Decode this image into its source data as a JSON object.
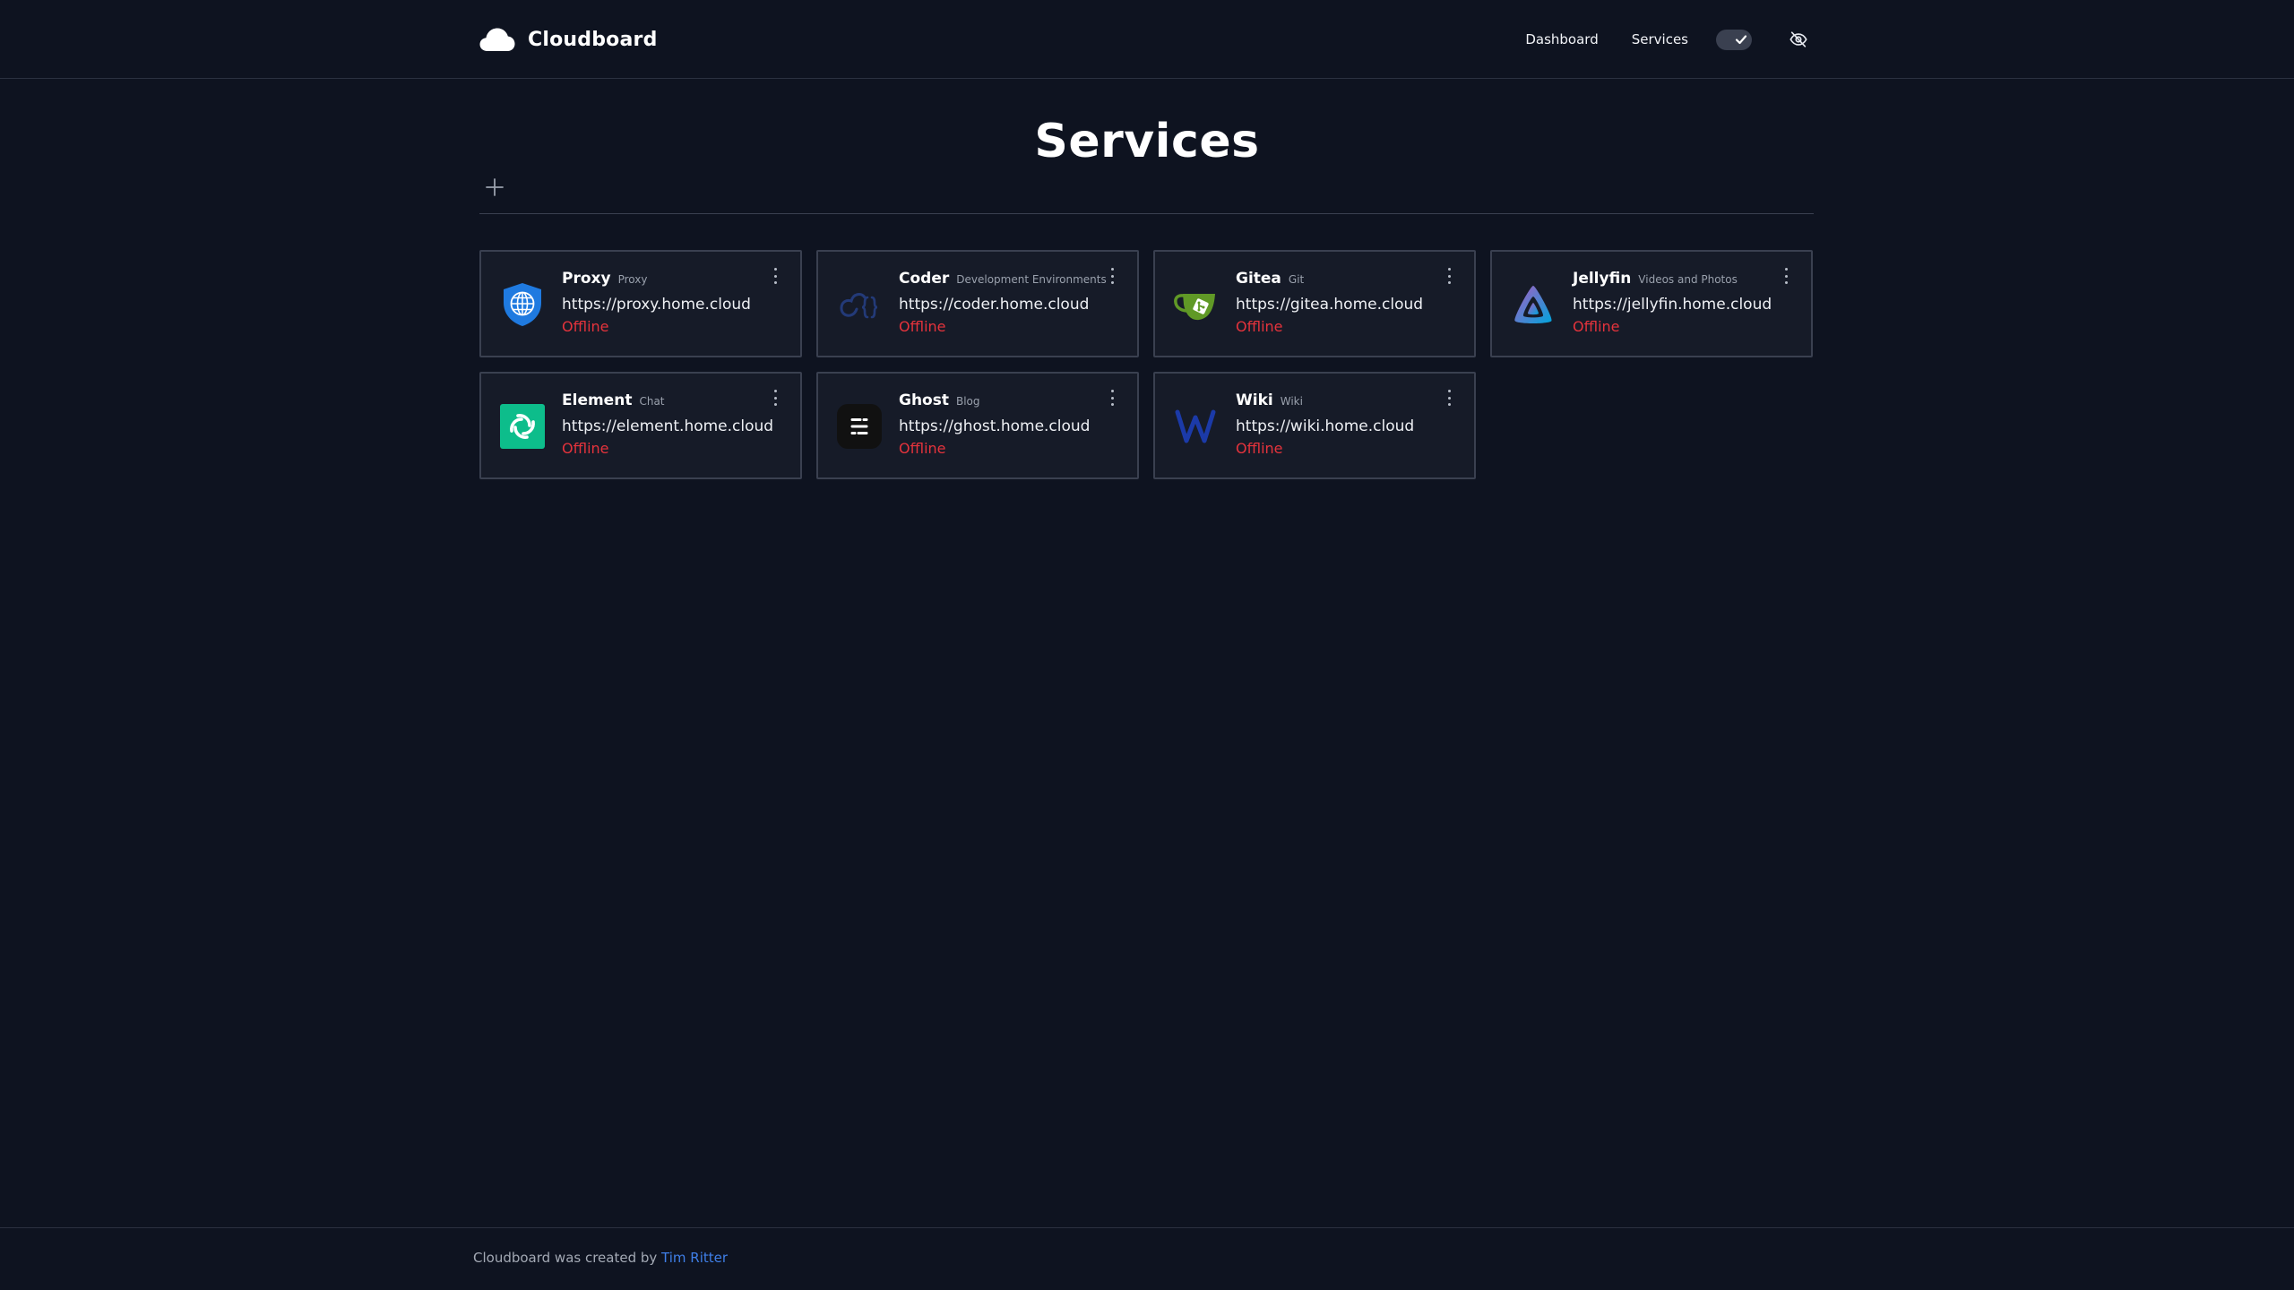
{
  "header": {
    "brand": "Cloudboard",
    "nav": {
      "dashboard": "Dashboard",
      "services": "Services"
    },
    "toggle_checked": true,
    "icons": {
      "logo": "cloud-icon",
      "toggle": "check-icon",
      "visibility": "eye-off-icon"
    }
  },
  "main": {
    "title": "Services",
    "add_icon": "plus-icon"
  },
  "services": [
    {
      "name": "Proxy",
      "category": "Proxy",
      "url": "https://proxy.home.cloud",
      "status": "Offline",
      "icon": "globe-shield-icon"
    },
    {
      "name": "Coder",
      "category": "Development Environments",
      "url": "https://coder.home.cloud",
      "status": "Offline",
      "icon": "coder-icon"
    },
    {
      "name": "Gitea",
      "category": "Git",
      "url": "https://gitea.home.cloud",
      "status": "Offline",
      "icon": "gitea-teacup-icon"
    },
    {
      "name": "Jellyfin",
      "category": "Videos and Photos",
      "url": "https://jellyfin.home.cloud",
      "status": "Offline",
      "icon": "jellyfin-triangle-icon"
    },
    {
      "name": "Element",
      "category": "Chat",
      "url": "https://element.home.cloud",
      "status": "Offline",
      "icon": "element-icon"
    },
    {
      "name": "Ghost",
      "category": "Blog",
      "url": "https://ghost.home.cloud",
      "status": "Offline",
      "icon": "ghost-icon"
    },
    {
      "name": "Wiki",
      "category": "Wiki",
      "url": "https://wiki.home.cloud",
      "status": "Offline",
      "icon": "wiki-w-icon"
    }
  ],
  "footer": {
    "text": "Cloudboard was created by ",
    "author": "Tim Ritter"
  },
  "colors": {
    "background": "#0e1320",
    "card_background": "#161b28",
    "card_border": "#3a4050",
    "status_offline": "#e5333c",
    "link": "#3f7fe8"
  }
}
